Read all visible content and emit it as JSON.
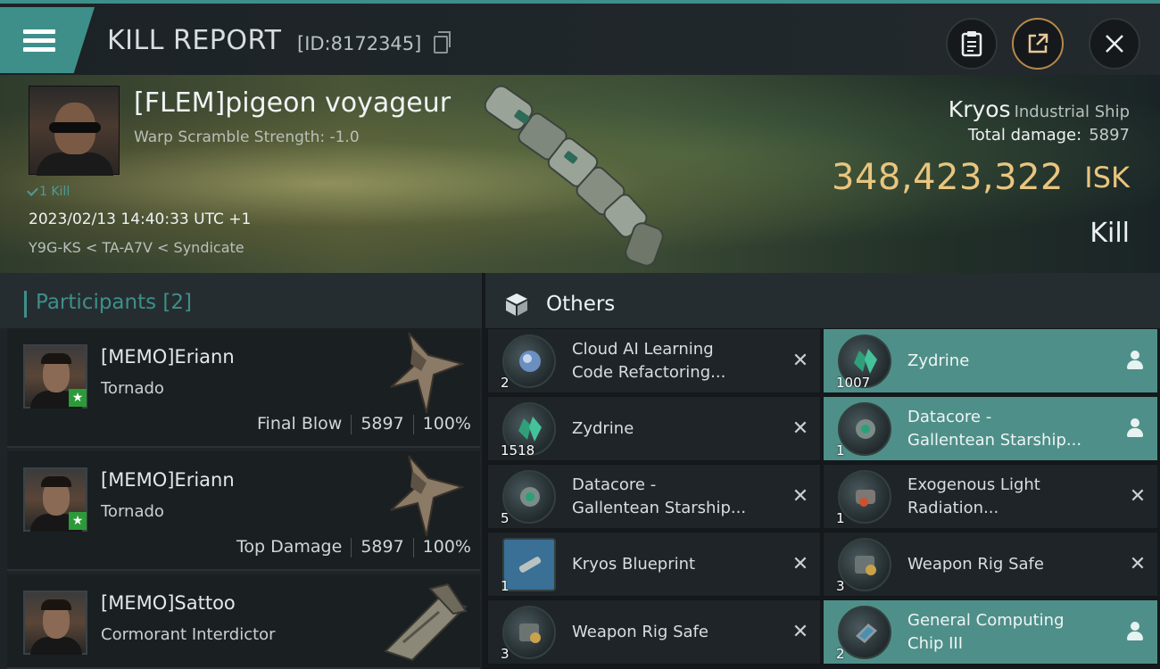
{
  "header": {
    "title": "KILL REPORT",
    "report_id": "[ID:8172345]"
  },
  "victim": {
    "name": "[FLEM]pigeon voyageur",
    "warp_scramble": "Warp Scramble Strength: -1.0",
    "kill_count": "1 Kill",
    "timestamp": "2023/02/13 14:40:33 UTC +1",
    "location": "Y9G-KS < TA-A7V < Syndicate",
    "ship_name": "Kryos",
    "ship_class": "Industrial Ship",
    "total_damage_label": "Total damage:",
    "total_damage": "5897",
    "isk_value": "348,423,322",
    "isk_label": "ISK",
    "result": "Kill"
  },
  "participants": {
    "title": "Participants",
    "count": "[2]",
    "rows": [
      {
        "name": "[MEMO]Eriann",
        "ship": "Tornado",
        "role": "Final Blow",
        "damage": "5897",
        "percent": "100%"
      },
      {
        "name": "[MEMO]Eriann",
        "ship": "Tornado",
        "role": "Top Damage",
        "damage": "5897",
        "percent": "100%"
      },
      {
        "name": "[MEMO]Sattoo",
        "ship": "Cormorant Interdictor"
      }
    ]
  },
  "others": {
    "title": "Others",
    "items": [
      {
        "name_1": "Cloud AI Learning",
        "name_2": "Code Refactoring...",
        "qty": "2"
      },
      {
        "name_1": "Zydrine",
        "qty": "1007"
      },
      {
        "name_1": "Zydrine",
        "qty": "1518"
      },
      {
        "name_1": "Datacore -",
        "name_2": "Gallentean Starship...",
        "qty": "1"
      },
      {
        "name_1": "Datacore -",
        "name_2": "Gallentean Starship...",
        "qty": "5"
      },
      {
        "name_1": "Exogenous Light",
        "name_2": "Radiation...",
        "qty": "1"
      },
      {
        "name_1": "Kryos Blueprint",
        "qty": "1"
      },
      {
        "name_1": "Weapon Rig Safe",
        "qty": "3"
      },
      {
        "name_1": "Weapon Rig Safe",
        "qty": "3"
      },
      {
        "name_1": "General Computing",
        "name_2": "Chip III",
        "qty": "2"
      }
    ]
  },
  "colors": {
    "accent": "#3e8f89",
    "isk_gold": "#e9c57f",
    "highlight_row": "#4f8f89"
  }
}
